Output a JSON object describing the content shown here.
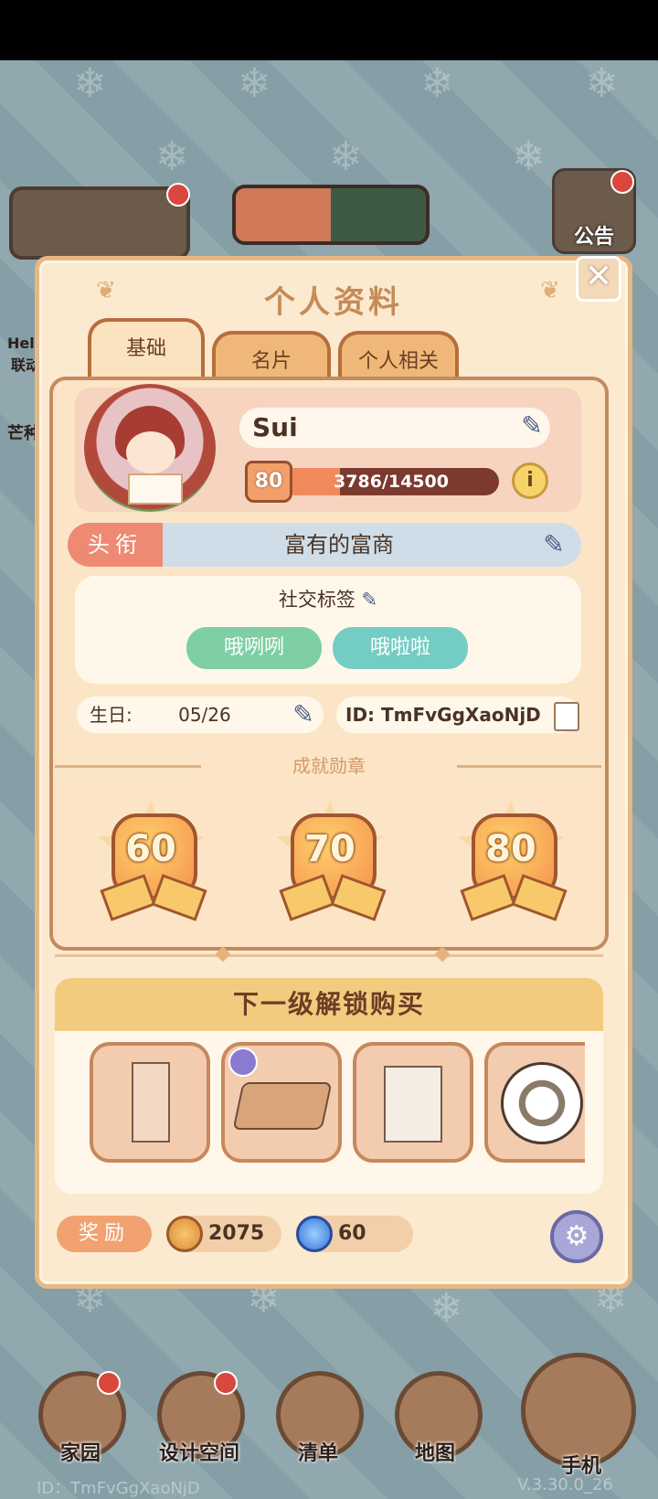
{
  "modal": {
    "title": "个人资料",
    "close_symbol": "✕",
    "tabs": [
      {
        "label": "基础",
        "active": true
      },
      {
        "label": "名片",
        "active": false
      },
      {
        "label": "个人相关",
        "active": false
      }
    ]
  },
  "profile": {
    "name": "Sui",
    "level": "80",
    "xp_text": "3786/14500",
    "xp_fraction": 0.261,
    "info_symbol": "i",
    "title_label": "头衔",
    "title_value": "富有的富商",
    "social_label": "社交标签",
    "tags": [
      "哦咧咧",
      "哦啦啦"
    ],
    "birthday_label": "生日:",
    "birthday_value": "05/26",
    "id_text": "ID: TmFvGgXaoNjD"
  },
  "achievements": {
    "heading": "成就勋章",
    "medals": [
      "60",
      "70",
      "80"
    ]
  },
  "unlock": {
    "heading": "下一级解锁购买",
    "items": [
      "pillar-item-icon",
      "package-item-icon",
      "laundry-basket-icon",
      "soccer-ball-icon"
    ]
  },
  "rewards": {
    "label": "奖励",
    "coins": "2075",
    "gems": "60"
  },
  "background": {
    "notice_label": "公告",
    "left_partial_1": "Hell",
    "left_partial_2": "联动",
    "left_partial_3": "芒种"
  },
  "nav": [
    {
      "label": "家园",
      "icon": "home-icon",
      "badge": true
    },
    {
      "label": "设计空间",
      "icon": "design-icon",
      "badge": true
    },
    {
      "label": "清单",
      "icon": "list-icon",
      "badge": false
    },
    {
      "label": "地图",
      "icon": "map-pin-icon",
      "badge": false
    },
    {
      "label": "手机",
      "icon": "phone-icon",
      "badge": false
    }
  ],
  "footer": {
    "id_text": "ID：TmFvGgXaoNjD",
    "version": "V.3.30.0_26"
  },
  "colors": {
    "accent": "#e9b784",
    "tag_green": "#7ecfa4",
    "tag_teal": "#74cdc4",
    "xp_fill": "#f18a5b"
  }
}
